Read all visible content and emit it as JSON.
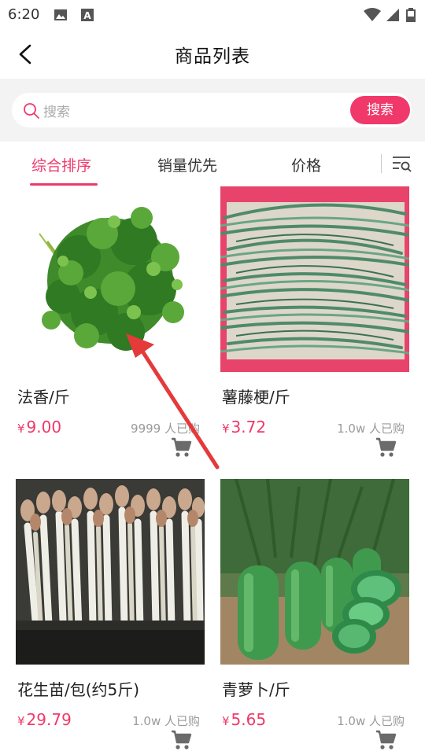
{
  "status_bar": {
    "time": "6:20",
    "icons": [
      "image-icon",
      "a-icon",
      "wifi-icon",
      "signal-icon",
      "battery-icon"
    ]
  },
  "nav": {
    "title": "商品列表",
    "back_icon": "chevron-left-icon"
  },
  "search": {
    "placeholder": "搜索",
    "button": "搜索"
  },
  "tabs": [
    {
      "label": "综合排序",
      "active": true
    },
    {
      "label": "销量优先",
      "active": false
    },
    {
      "label": "价格",
      "active": false
    }
  ],
  "products": [
    {
      "name": "法香/斤",
      "currency": "¥",
      "price": "9.00",
      "sold": "9999 人已购"
    },
    {
      "name": "薯藤梗/斤",
      "currency": "¥",
      "price": "3.72",
      "sold": "1.0w 人已购"
    },
    {
      "name": "花生苗/包(约5斤)",
      "currency": "¥",
      "price": "29.79",
      "sold": "1.0w 人已购"
    },
    {
      "name": "青萝卜/斤",
      "currency": "¥",
      "price": "5.65",
      "sold": "1.0w 人已购"
    }
  ],
  "colors": {
    "accent": "#f0386a",
    "annotation_arrow": "#e5393a"
  }
}
